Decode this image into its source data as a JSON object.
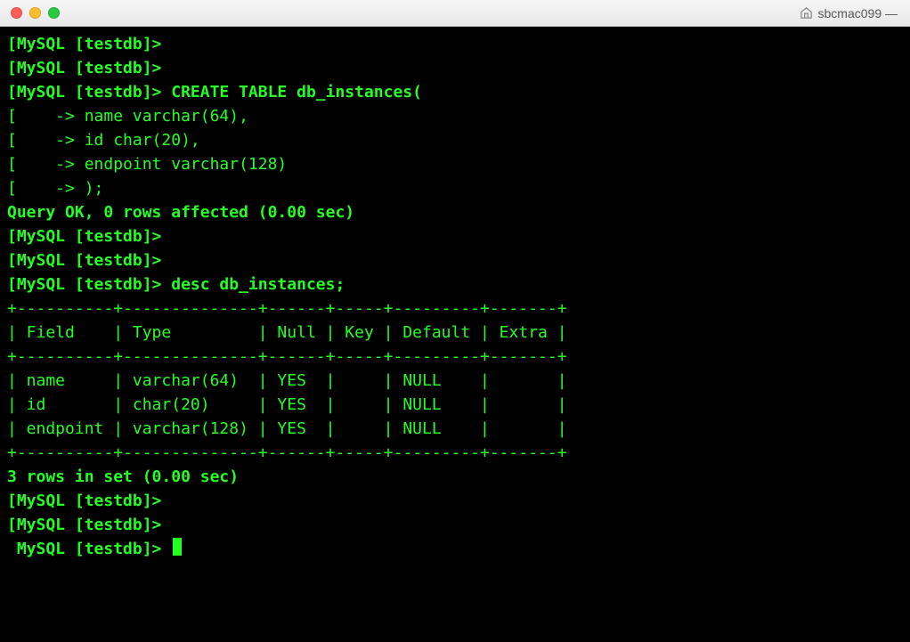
{
  "window": {
    "title": "sbcmac099 —"
  },
  "lines": [
    {
      "b": true,
      "t": "[MySQL [testdb]>"
    },
    {
      "b": true,
      "t": "[MySQL [testdb]>"
    },
    {
      "b": true,
      "t": "[MySQL [testdb]> CREATE TABLE db_instances("
    },
    {
      "b": false,
      "t": "[    -> name varchar(64),"
    },
    {
      "b": false,
      "t": "[    -> id char(20),"
    },
    {
      "b": false,
      "t": "[    -> endpoint varchar(128)"
    },
    {
      "b": false,
      "t": "[    -> );"
    },
    {
      "b": true,
      "t": "Query OK, 0 rows affected (0.00 sec)"
    },
    {
      "b": false,
      "t": ""
    },
    {
      "b": true,
      "t": "[MySQL [testdb]>"
    },
    {
      "b": true,
      "t": "[MySQL [testdb]>"
    },
    {
      "b": true,
      "t": "[MySQL [testdb]> desc db_instances;"
    },
    {
      "b": false,
      "t": "+----------+--------------+------+-----+---------+-------+"
    },
    {
      "b": false,
      "t": "| Field    | Type         | Null | Key | Default | Extra |"
    },
    {
      "b": false,
      "t": "+----------+--------------+------+-----+---------+-------+"
    },
    {
      "b": false,
      "t": "| name     | varchar(64)  | YES  |     | NULL    |       |"
    },
    {
      "b": false,
      "t": "| id       | char(20)     | YES  |     | NULL    |       |"
    },
    {
      "b": false,
      "t": "| endpoint | varchar(128) | YES  |     | NULL    |       |"
    },
    {
      "b": false,
      "t": "+----------+--------------+------+-----+---------+-------+"
    },
    {
      "b": true,
      "t": "3 rows in set (0.00 sec)"
    },
    {
      "b": false,
      "t": ""
    },
    {
      "b": true,
      "t": "[MySQL [testdb]>"
    },
    {
      "b": true,
      "t": "[MySQL [testdb]>"
    },
    {
      "b": true,
      "t": " MySQL [testdb]> ",
      "cursor": true
    }
  ]
}
